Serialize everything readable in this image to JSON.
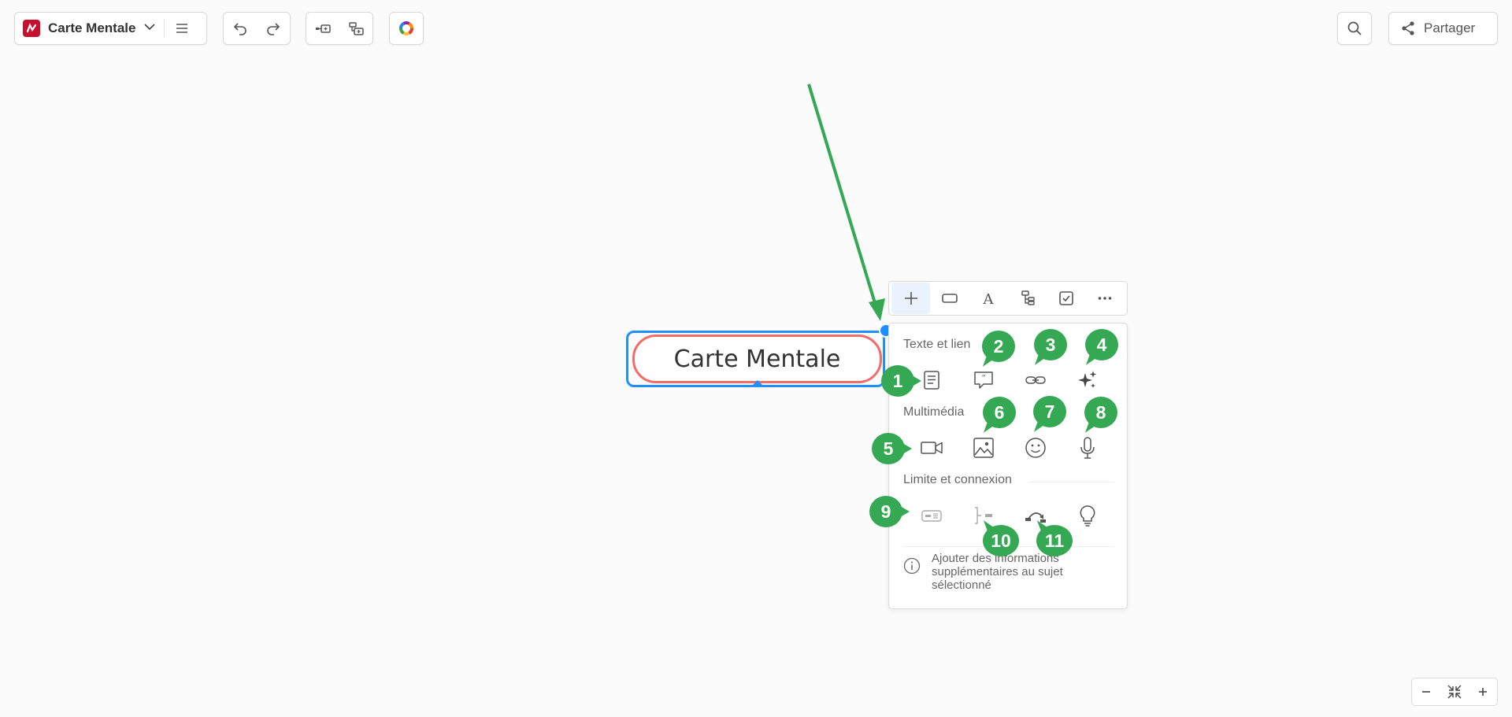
{
  "app": {
    "title": "Carte Mentale",
    "share_label": "Partager",
    "brand_color": "#c8102e"
  },
  "topic": {
    "label": "Carte Mentale",
    "border_color": "#f36b6b",
    "selection_color": "#1e90ff"
  },
  "popup": {
    "tabs": [
      "add-icon",
      "shape-icon",
      "text-style-icon",
      "structure-icon",
      "task-icon",
      "more-icon"
    ],
    "sections": [
      {
        "title": "Texte et lien",
        "items": [
          "note-icon",
          "comment-icon",
          "link-icon",
          "ai-sparkle-icon"
        ]
      },
      {
        "title": "Multimédia",
        "items": [
          "video-icon",
          "image-icon",
          "emoji-icon",
          "audio-icon"
        ]
      },
      {
        "title": "Limite et connexion",
        "items": [
          "boundary-icon",
          "summary-icon",
          "relationship-icon",
          "idea-icon"
        ]
      }
    ],
    "hint": "Ajouter des informations supplémentaires au sujet sélectionné"
  },
  "annotations": {
    "color": "#35a853",
    "markers": [
      "1",
      "2",
      "3",
      "4",
      "5",
      "6",
      "7",
      "8",
      "9",
      "10",
      "11"
    ]
  }
}
